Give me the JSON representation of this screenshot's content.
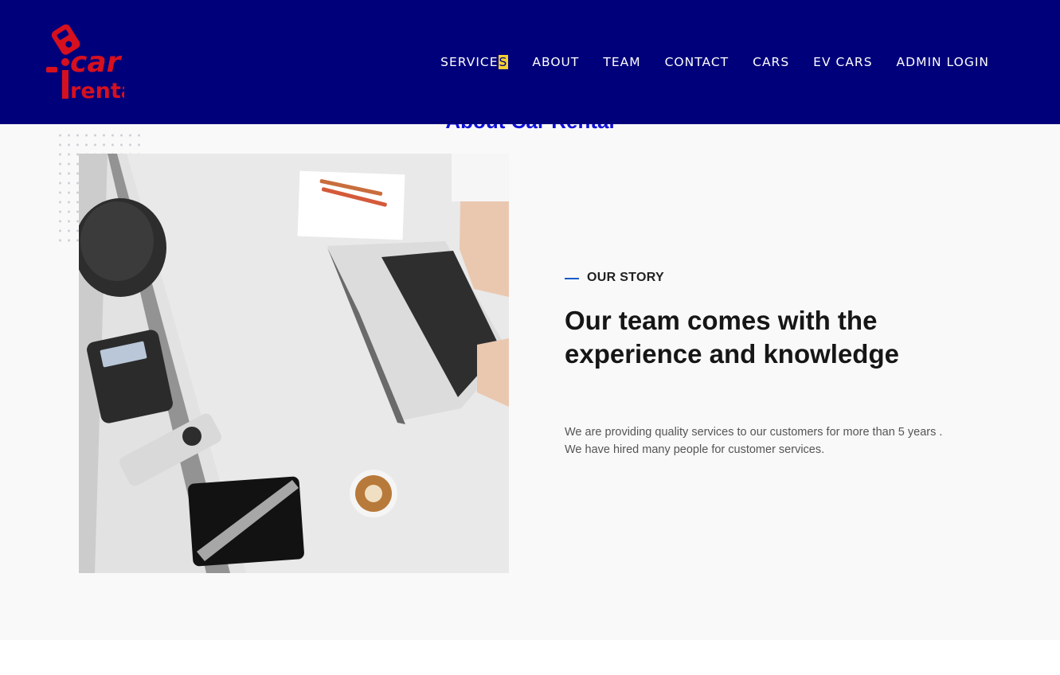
{
  "logo": {
    "word1": "car",
    "word2": "rental",
    "color": "#d6101e"
  },
  "nav": {
    "services": "SERVICES",
    "about": "ABOUT",
    "team": "TEAM",
    "contact": "CONTACT",
    "cars": "CARS",
    "ev_cars": "EV CARS",
    "admin_login": "ADMIN LOGIN"
  },
  "about": {
    "title": "About Car Rental",
    "eyebrow": "OUR STORY",
    "headline_line1": "Our team comes with the",
    "headline_line2": "experience and knowledge",
    "desc_line1": "We are providing quality services to our customers for more than 5 years .",
    "desc_line2": "We have hired many people for customer services."
  },
  "colors": {
    "header_bg": "#00007b",
    "accent": "#1a5bc7",
    "title_blue": "#1010d8",
    "highlight": "#f5d130"
  },
  "icons": {
    "logo_key": "car-key-logo-icon"
  }
}
